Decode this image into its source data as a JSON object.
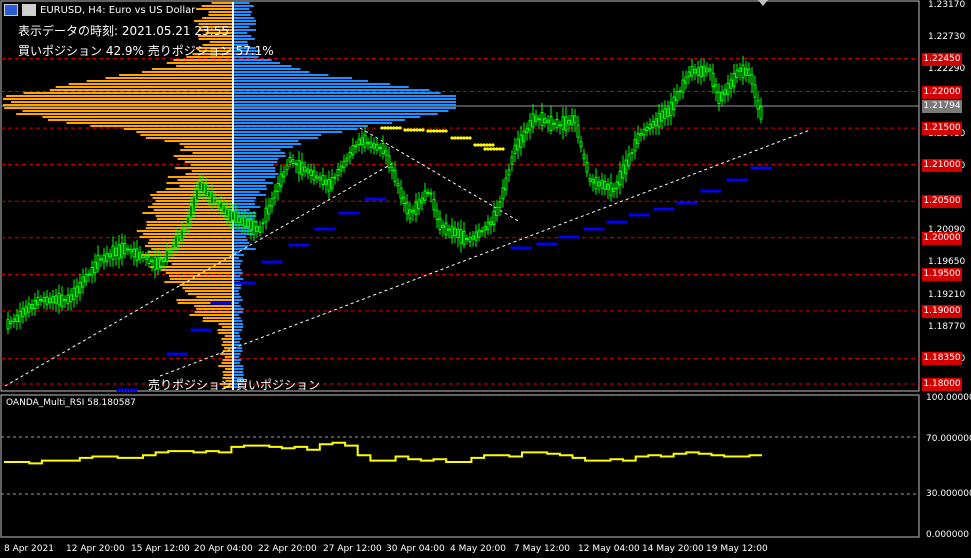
{
  "header": {
    "symbol_line": "EURUSD, H4:  Euro vs US Dollar",
    "data_time": "表示データの時刻: 2021.05.21 23:55",
    "position_ratio": "買いポジション 42.9% 売りポジション 57.1%"
  },
  "legend": {
    "sell_label": "売りポジション",
    "buy_label": "買いポジション"
  },
  "price_axis": {
    "ticks": [
      "1.23170",
      "1.22730",
      "1.22290",
      "1.21410",
      "1.20970",
      "1.20090",
      "1.19650",
      "1.19210",
      "1.18770",
      "1.18330"
    ],
    "level_tags": [
      "1.22450",
      "1.22000",
      "1.21500",
      "1.21000",
      "1.20500",
      "1.20000",
      "1.19500",
      "1.19000",
      "1.18350",
      "1.18000"
    ],
    "current_price": "1.21794"
  },
  "rsi": {
    "title": "OANDA_Multi_RSI 58.180587",
    "ticks": [
      "100.000000",
      "70.000000",
      "30.000000",
      "0.000000"
    ],
    "values": [
      54,
      54,
      53,
      55,
      55,
      55,
      57,
      58,
      58,
      57,
      57,
      59,
      61,
      62,
      62,
      61,
      62,
      61,
      65,
      66,
      66,
      65,
      64,
      65,
      63,
      67,
      68,
      66,
      59,
      55,
      55,
      58,
      56,
      55,
      56,
      54,
      54,
      57,
      59,
      59,
      58,
      61,
      61,
      60,
      59,
      57,
      55,
      55,
      56,
      55,
      58,
      59,
      58,
      60,
      61,
      60,
      59,
      58,
      58,
      59
    ]
  },
  "time_axis": {
    "labels": [
      "8 Apr 2021",
      "12 Apr 20:00",
      "15 Apr 12:00",
      "20 Apr 04:00",
      "22 Apr 20:00",
      "27 Apr 12:00",
      "30 Apr 04:00",
      "4 May 20:00",
      "7 May 12:00",
      "12 May 04:00",
      "14 May 20:00",
      "19 May 12:00"
    ]
  },
  "colors": {
    "sell_profile": "#ffa500",
    "buy_profile": "#1e90ff",
    "candle": "#00ff00",
    "level_line": "#d40000",
    "rsi_line": "#ffff00",
    "dots_blue": "#0000ff",
    "dots_yellow": "#ffff00"
  }
}
